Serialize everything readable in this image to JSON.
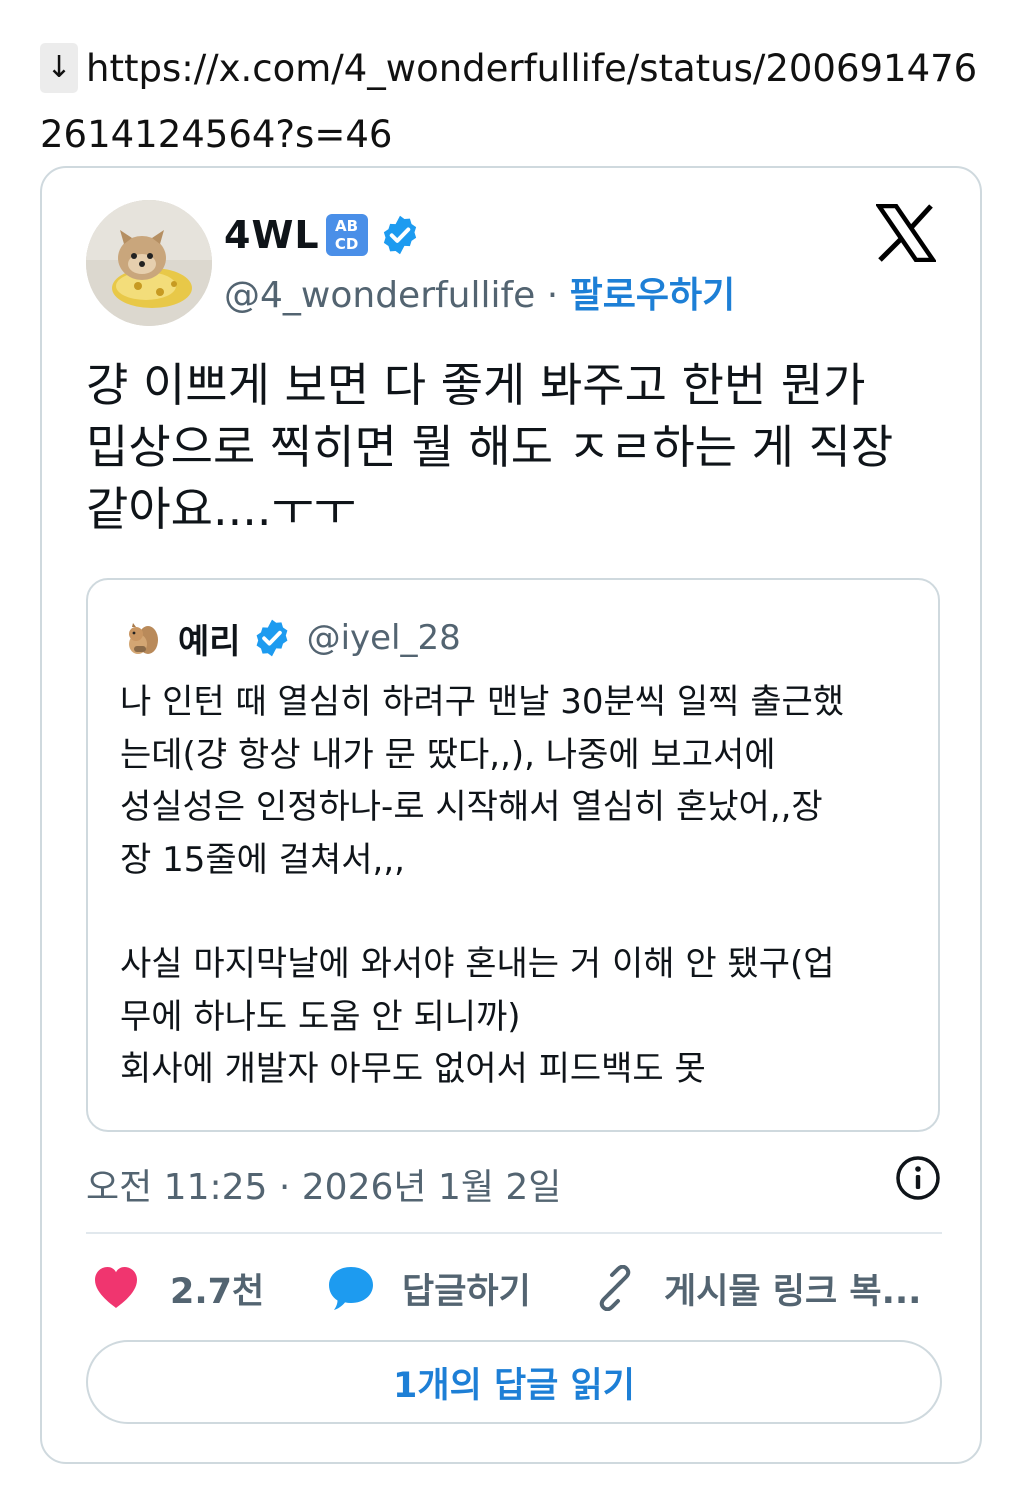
{
  "url_line": {
    "arrow": "↓",
    "text": "https://x.com/4_wonderfullife/status/2006914762614124564?s=46"
  },
  "tweet": {
    "display_name": "4WL",
    "name_badge": {
      "top": "AB",
      "bottom": "CD",
      "color": "#4a8fe8"
    },
    "verified_icon": "verified-badge-icon",
    "handle": "@4_wonderfullife",
    "separator": "·",
    "follow_label": "팔로우하기",
    "platform_icon": "x-logo-icon",
    "text_lines": [
      "걍 이쁘게 보면 다 좋게 봐주고 한번 뭔가",
      "밉상으로 찍히면 뭘 해도 ㅈㄹ하는 게 직장",
      "같아요....ㅜㅜ"
    ]
  },
  "quoted_tweet": {
    "display_name": "예리",
    "handle": "@iyel_28",
    "paragraph1_lines": [
      "나 인턴 때 열심히 하려구 맨날 30분씩 일찍 출근했",
      "는데(걍 항상 내가 문 땄다,,), 나중에 보고서에",
      "성실성은 인정하나-로 시작해서 열심히 혼났어,,장",
      "장 15줄에 걸쳐서,,,"
    ],
    "paragraph2_lines": [
      "사실 마지막날에 와서야 혼내는 거 이해 안 됐구(업",
      "무에 하나도 도움 안 되니까)",
      "회사에 개발자 아무도 없어서 피드백도 못"
    ]
  },
  "meta": {
    "timestamp": "오전 11:25 · 2026년 1월 2일",
    "info_icon": "info-icon"
  },
  "actions": {
    "like_count": "2.7천",
    "reply_label": "답글하기",
    "copy_link_label": "게시물 링크 복...",
    "like_color": "#f91880",
    "reply_color": "#1d9bf0"
  },
  "read_replies_label": "1개의 답글 읽기",
  "colors": {
    "accent": "#1d7fd6",
    "secondary_text": "#536471",
    "border": "#cfd9de"
  }
}
